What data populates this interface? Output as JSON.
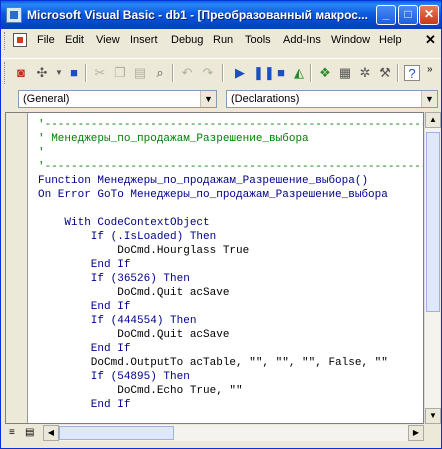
{
  "window": {
    "title": "Microsoft Visual Basic - db1 - [Преобразованный макрос..."
  },
  "menu": {
    "items": [
      "File",
      "Edit",
      "View",
      "Insert",
      "Debug",
      "Run",
      "Tools",
      "Add-Ins",
      "Window",
      "Help"
    ]
  },
  "dropdowns": {
    "object": "(General)",
    "procedure": "(Declarations)"
  },
  "code": {
    "lines": [
      {
        "text": "'------------------------------------------------------------",
        "kind": "cmt"
      },
      {
        "text": "' Менеджеры_по_продажам_Разрешение_выбора",
        "kind": "cmt"
      },
      {
        "text": "'",
        "kind": "cmt"
      },
      {
        "text": "'------------------------------------------------------------",
        "kind": "cmt"
      },
      {
        "text": "Function Менеджеры_по_продажам_Разрешение_выбора()",
        "kind": "kw"
      },
      {
        "text": "On Error GoTo Менеджеры_по_продажам_Разрешение_выбора",
        "kind": "kw"
      },
      {
        "text": "",
        "kind": "txt"
      },
      {
        "text": "    With CodeContextObject",
        "kind": "kw"
      },
      {
        "text": "        If (.IsLoaded) Then",
        "kind": "kw"
      },
      {
        "text": "            DoCmd.Hourglass True",
        "kind": "txt"
      },
      {
        "text": "        End If",
        "kind": "kw"
      },
      {
        "text": "        If (36526) Then",
        "kind": "kw"
      },
      {
        "text": "            DoCmd.Quit acSave",
        "kind": "txt"
      },
      {
        "text": "        End If",
        "kind": "kw"
      },
      {
        "text": "        If (444554) Then",
        "kind": "kw"
      },
      {
        "text": "            DoCmd.Quit acSave",
        "kind": "txt"
      },
      {
        "text": "        End If",
        "kind": "kw"
      },
      {
        "text": "        DoCmd.OutputTo acTable, \"\", \"\", \"\", False, \"\"",
        "kind": "txt"
      },
      {
        "text": "        If (54895) Then",
        "kind": "kw"
      },
      {
        "text": "            DoCmd.Echo True, \"\"",
        "kind": "txt"
      },
      {
        "text": "        End If",
        "kind": "kw"
      }
    ]
  }
}
